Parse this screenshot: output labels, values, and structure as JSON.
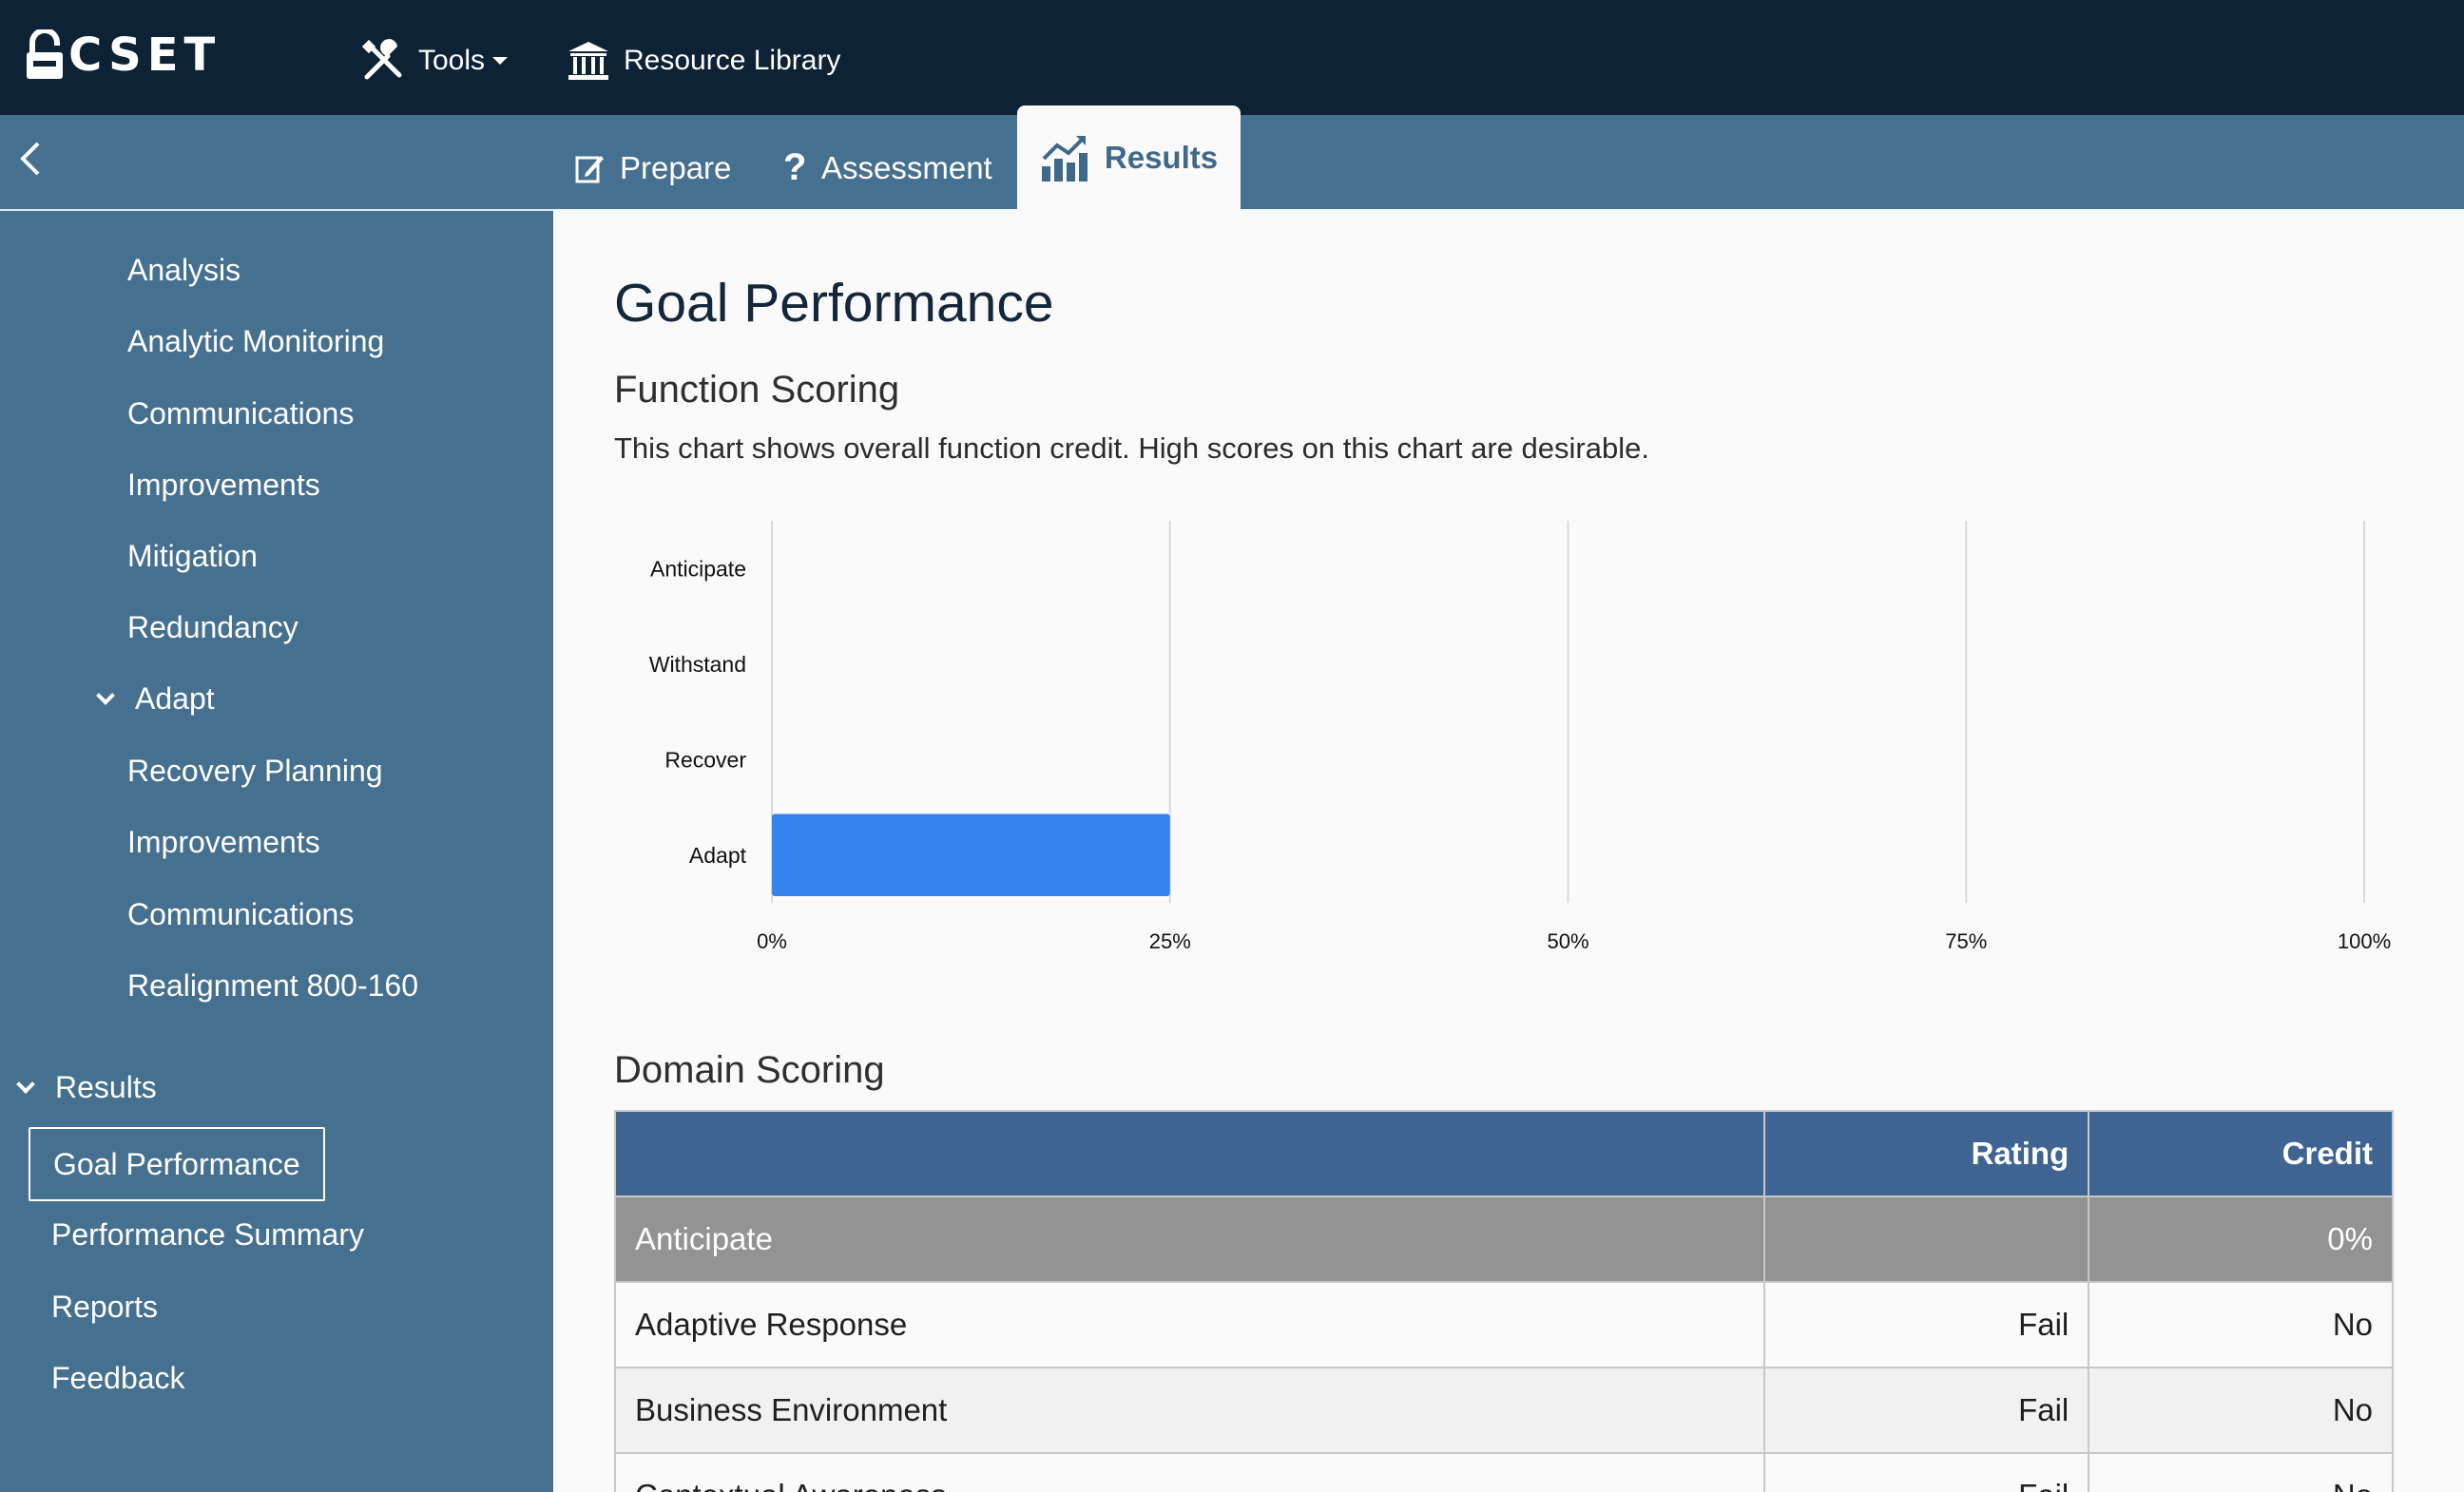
{
  "header": {
    "logo_text": "CSET",
    "tools_label": "Tools",
    "resource_library_label": "Resource Library"
  },
  "tabs": {
    "prepare": "Prepare",
    "assessment": "Assessment",
    "results": "Results"
  },
  "sidebar": {
    "items": [
      {
        "label": "Analysis"
      },
      {
        "label": "Analytic Monitoring"
      },
      {
        "label": "Communications"
      },
      {
        "label": "Improvements"
      },
      {
        "label": "Mitigation"
      },
      {
        "label": "Redundancy"
      },
      {
        "label": "Adapt"
      },
      {
        "label": "Recovery Planning"
      },
      {
        "label": "Improvements"
      },
      {
        "label": "Communications"
      },
      {
        "label": "Realignment 800-160"
      },
      {
        "label": "Results"
      },
      {
        "label": "Goal Performance"
      },
      {
        "label": "Performance Summary"
      },
      {
        "label": "Reports"
      },
      {
        "label": "Feedback"
      }
    ]
  },
  "main": {
    "title": "Goal Performance",
    "function_scoring_heading": "Function Scoring",
    "function_scoring_desc": "This chart shows overall function credit. High scores on this chart are desirable.",
    "domain_scoring_heading": "Domain Scoring"
  },
  "colors": {
    "bar": "#3584ee",
    "header_bg": "#0e2235",
    "nav_bg": "#46708f",
    "table_header_bg": "#3f6491",
    "group_row_bg": "#939393"
  },
  "chart_data": {
    "type": "bar",
    "orientation": "horizontal",
    "categories": [
      "Anticipate",
      "Withstand",
      "Recover",
      "Adapt"
    ],
    "values": [
      0,
      0,
      0,
      25
    ],
    "xlim": [
      0,
      100
    ],
    "x_ticks": [
      "0%",
      "25%",
      "50%",
      "75%",
      "100%"
    ],
    "grid": true,
    "title": "",
    "xlabel": "",
    "ylabel": ""
  },
  "table": {
    "headers": [
      "",
      "Rating",
      "Credit"
    ],
    "rows": [
      {
        "type": "group",
        "cells": [
          "Anticipate",
          "",
          "0%"
        ]
      },
      {
        "type": "row",
        "cells": [
          "Adaptive Response",
          "Fail",
          "No"
        ]
      },
      {
        "type": "row",
        "cells": [
          "Business Environment",
          "Fail",
          "No"
        ]
      },
      {
        "type": "row",
        "cells": [
          "Contextual Awareness",
          "Fail",
          "No"
        ]
      }
    ]
  }
}
